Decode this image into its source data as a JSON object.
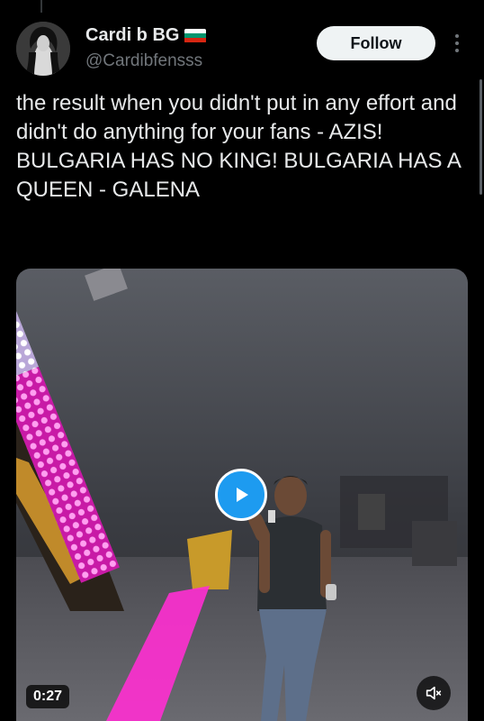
{
  "author": {
    "display_name": "Cardi b BG",
    "handle": "@Cardibfensss",
    "flag_icon": "bulgaria-flag-icon",
    "flag_colors": [
      "#ffffff",
      "#00966e",
      "#d62612"
    ]
  },
  "follow_label": "Follow",
  "more_icon": "more-vertical-icon",
  "tweet_text": "the result when you didn't put in any effort and didn't do anything for your fans - AZIS!\nBULGARIA HAS NO KING! BULGARIA HAS A QUEEN - GALENA",
  "video": {
    "duration": "0:27",
    "play_icon": "play-icon",
    "mute_icon": "muted-speaker-icon"
  },
  "colors": {
    "accent": "#1d9bf0",
    "background": "#000000",
    "text": "#e7e9ea",
    "secondary_text": "#71767b",
    "led_pink": "#ff2fd2"
  }
}
